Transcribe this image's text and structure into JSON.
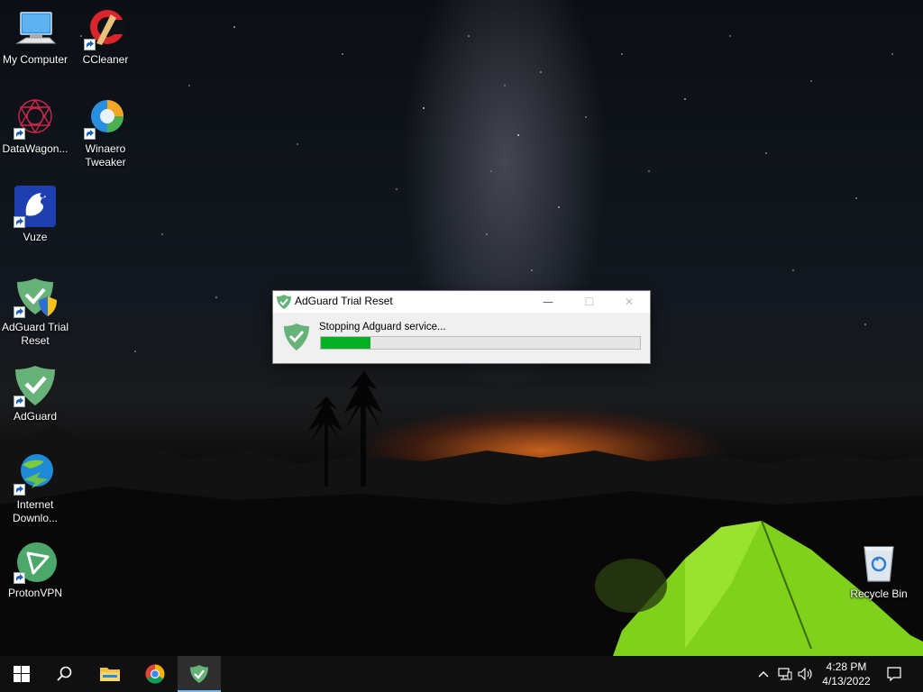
{
  "desktop": {
    "icons": [
      {
        "label": "My Computer",
        "icon": "computer-icon"
      },
      {
        "label": "CCleaner",
        "icon": "ccleaner-icon"
      },
      {
        "label": "DataWagon...",
        "icon": "datawagon-icon"
      },
      {
        "label": "Winaero Tweaker",
        "icon": "winaero-tweaker-icon"
      },
      {
        "label": "Vuze",
        "icon": "vuze-icon"
      },
      {
        "label": "AdGuard Trial Reset",
        "icon": "adguard-trial-reset-icon"
      },
      {
        "label": "AdGuard",
        "icon": "adguard-icon"
      },
      {
        "label": "Internet Downlo...",
        "icon": "internet-download-manager-icon"
      },
      {
        "label": "ProtonVPN",
        "icon": "protonvpn-icon"
      },
      {
        "label": "Recycle Bin",
        "icon": "recycle-bin-icon"
      }
    ]
  },
  "dialog": {
    "title": "AdGuard Trial Reset",
    "status": "Stopping Adguard service...",
    "progress_fraction": 0.155,
    "controls": {
      "minimize": "—",
      "maximize": "☐",
      "close": "✕"
    }
  },
  "taskbar": {
    "items": [
      "start-icon",
      "search-icon",
      "file-explorer-icon",
      "chrome-icon",
      "adguard-trial-reset-taskbar-icon"
    ],
    "clock": {
      "time": "4:28 PM",
      "date": "4/13/2022"
    },
    "tray": [
      "chevron-up-icon",
      "network-icon",
      "volume-icon",
      "notification-icon"
    ]
  },
  "colors": {
    "progress": "#06b025",
    "adguard_green": "#67b279",
    "taskbar": "#101010",
    "active_accent": "#76b9ed"
  }
}
